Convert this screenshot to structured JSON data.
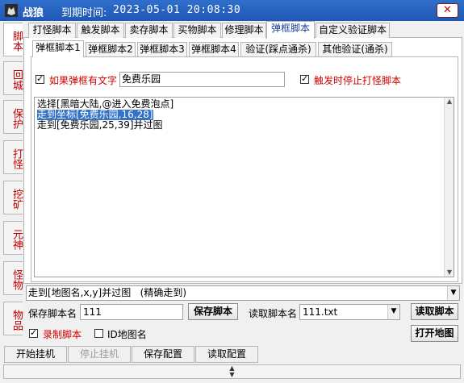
{
  "window": {
    "title": "战狼",
    "expire_label": "到期时间:",
    "expire_value": "2023-05-01 20:08:30",
    "close_icon": "✕"
  },
  "left_tabs": [
    {
      "label": "脚本",
      "active": true
    },
    {
      "label": "回城"
    },
    {
      "label": "保护"
    },
    {
      "label": "打怪"
    },
    {
      "label": "挖矿"
    },
    {
      "label": "元神"
    },
    {
      "label": "怪物"
    },
    {
      "label": "物品"
    }
  ],
  "top_tabs": [
    {
      "label": "打怪脚本"
    },
    {
      "label": "触发脚本"
    },
    {
      "label": "卖存脚本"
    },
    {
      "label": "买物脚本"
    },
    {
      "label": "修理脚本"
    },
    {
      "label": "弹框脚本",
      "active": true
    },
    {
      "label": "自定义验证脚本"
    }
  ],
  "sub_tabs": [
    {
      "label": "弹框脚本1",
      "active": true
    },
    {
      "label": "弹框脚本2"
    },
    {
      "label": "弹框脚本3"
    },
    {
      "label": "弹框脚本4"
    },
    {
      "label": "验证(踩点通杀)"
    },
    {
      "label": "其他验证(通杀)"
    }
  ],
  "popup_text": {
    "checkbox_label": "如果弹框有文字",
    "checked": true,
    "value": "免费乐园"
  },
  "stop_on_trigger": {
    "checkbox_label": "触发时停止打怪脚本",
    "checked": true
  },
  "script_lines": [
    {
      "text": "选择[黑暗大陆,@进入免费泡点]",
      "selected": false
    },
    {
      "text": "走到坐标[免费乐园,16,28]",
      "selected": true
    },
    {
      "text": "走到[免费乐园,25,39]并过图",
      "selected": false
    }
  ],
  "command_combo": {
    "value": "走到[地图名,x,y]并过图   (精确走到)"
  },
  "save_section": {
    "label": "保存脚本名",
    "value": "111",
    "button": "保存脚本"
  },
  "load_section": {
    "label": "读取脚本名",
    "value": "111.txt",
    "button": "读取脚本"
  },
  "record_script": {
    "label": "录制脚本",
    "checked": true
  },
  "id_map_name": {
    "label": "ID地图名",
    "checked": false
  },
  "open_map_button": "打开地图",
  "bottom_buttons": [
    {
      "label": "开始挂机",
      "enabled": true
    },
    {
      "label": "停止挂机",
      "enabled": false
    },
    {
      "label": "保存配置",
      "enabled": true
    },
    {
      "label": "读取配置",
      "enabled": true
    }
  ],
  "colors": {
    "titlebar": "#1f57b5",
    "selection": "#3372c5",
    "accent_red": "#d40000"
  }
}
